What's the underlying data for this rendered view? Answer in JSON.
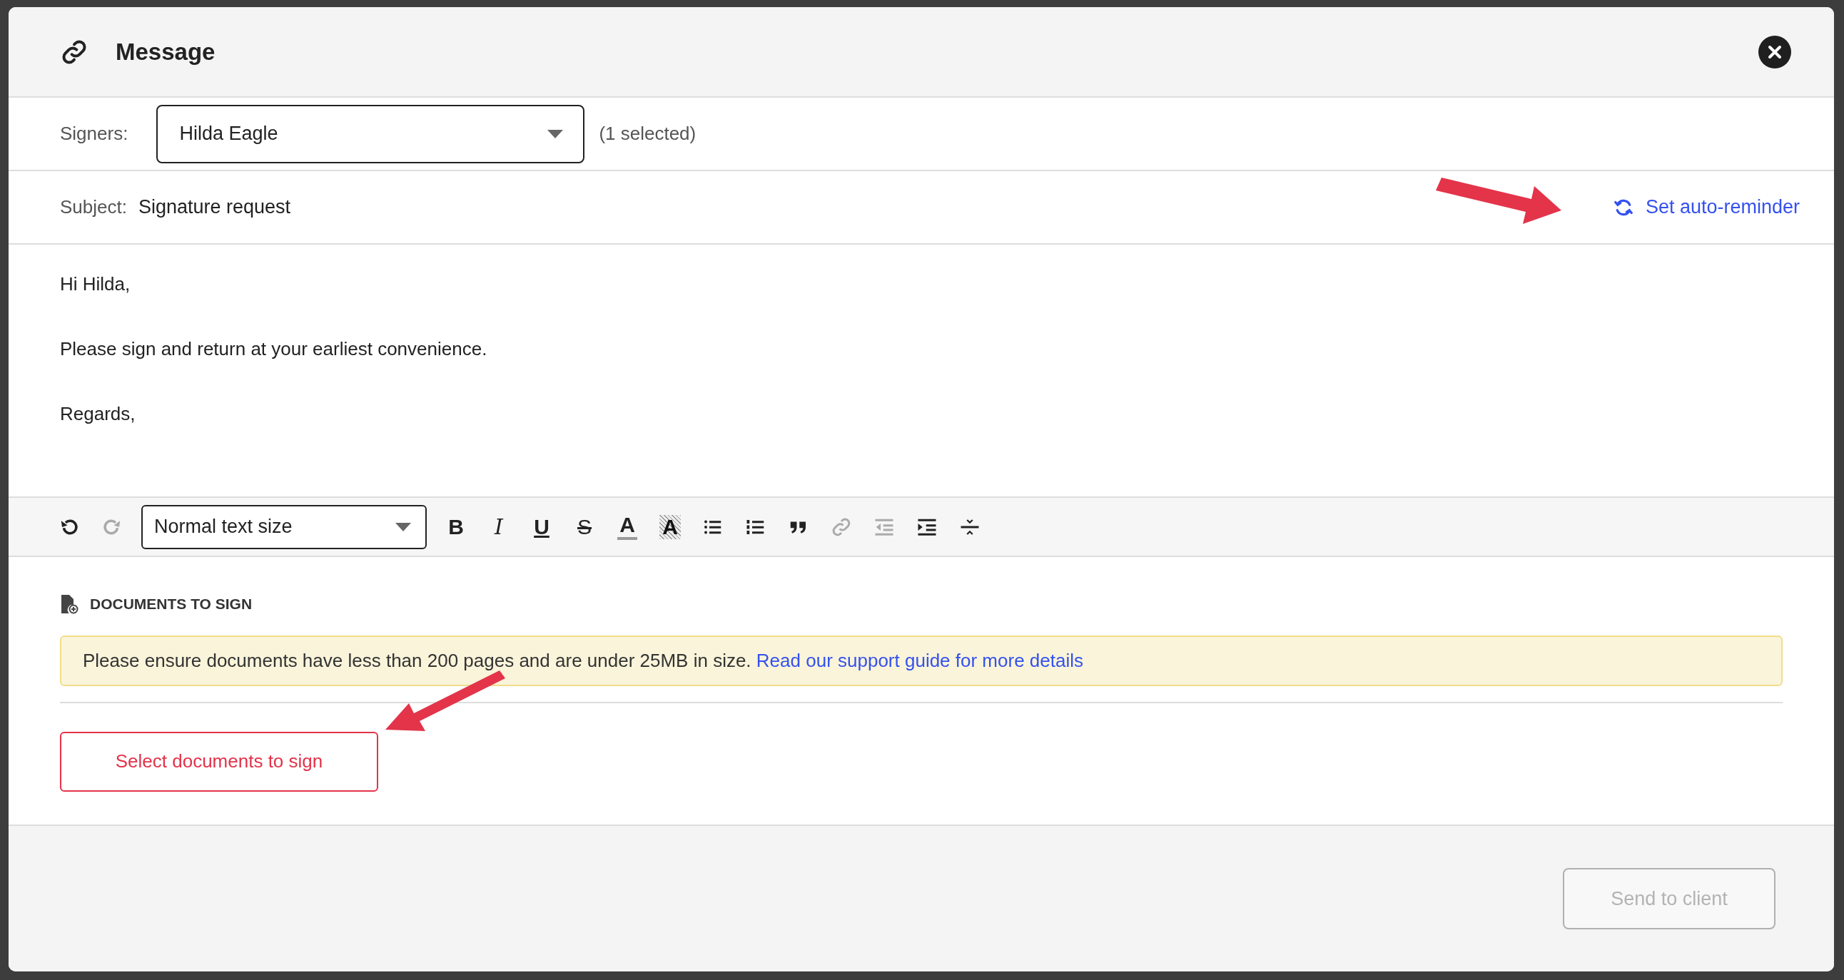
{
  "dialog": {
    "title": "Message"
  },
  "signers": {
    "label": "Signers:",
    "value": "Hilda Eagle",
    "count": "(1 selected)"
  },
  "subject": {
    "label": "Subject:",
    "value": "Signature request",
    "reminder_link": "Set auto-reminder"
  },
  "body": [
    "Hi Hilda,",
    "Please sign and return at your earliest convenience.",
    "Regards,"
  ],
  "toolbar": [
    {
      "kind": "undo",
      "disabled": false
    },
    {
      "kind": "redo",
      "disabled": true
    },
    {
      "kind": "select",
      "value": "Normal text size",
      "disabled": false
    },
    {
      "kind": "bold",
      "label": "B",
      "disabled": false
    },
    {
      "kind": "italic",
      "label": "I",
      "disabled": false
    },
    {
      "kind": "underline",
      "label": "U",
      "disabled": false
    },
    {
      "kind": "strike",
      "label": "S",
      "disabled": false
    },
    {
      "kind": "color",
      "label": "A",
      "disabled": false
    },
    {
      "kind": "highlight",
      "label": "A",
      "disabled": false
    },
    {
      "kind": "bullets",
      "disabled": false
    },
    {
      "kind": "numbers",
      "disabled": false
    },
    {
      "kind": "quote",
      "disabled": false
    },
    {
      "kind": "link",
      "disabled": true
    },
    {
      "kind": "outdent",
      "disabled": true
    },
    {
      "kind": "indent",
      "disabled": false
    },
    {
      "kind": "rule",
      "disabled": false
    }
  ],
  "documents": {
    "heading": "DOCUMENTS TO SIGN",
    "notice": "Please ensure documents have less than 200 pages and are under 25MB in size.",
    "notice_link": "Read our support guide for more details",
    "button": "Select documents to sign"
  },
  "footer": {
    "send_button": {
      "label": "Send to client",
      "disabled": true
    }
  }
}
